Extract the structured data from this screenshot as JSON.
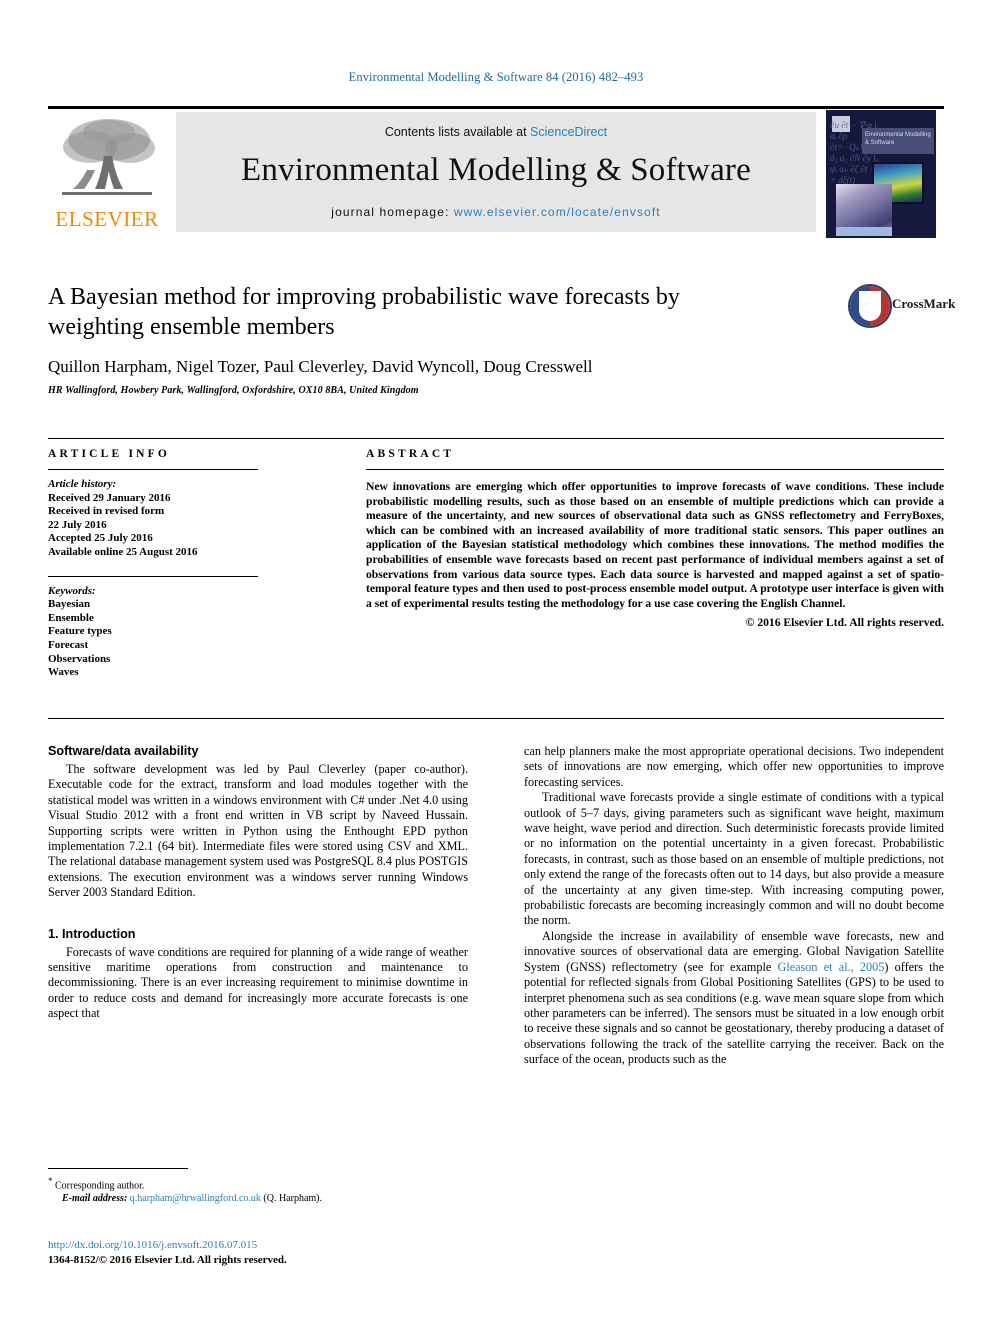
{
  "running_head": "Environmental Modelling & Software 84 (2016) 482–493",
  "masthead": {
    "contents_prefix": "Contents lists available at ",
    "sciencedirect": "ScienceDirect",
    "journal_name": "Environmental Modelling & Software",
    "homepage_prefix": "journal homepage: ",
    "homepage_url": "www.elsevier.com/locate/envsoft",
    "publisher_wordmark": "ELSEVIER",
    "cover_title": "Environmental Modelling & Software",
    "cover_equations": "∂u ∂t − ∇·φ ∫ᵢ αᵢ ∂ρ ∂t=−Qₖ∇ + d₁ a₁ ∂N ∂y ∫₀ ψᵢ αₖ ∂ζ ∂t − + dξ(t)"
  },
  "accent_colors": {
    "link_blue": "#2a7fb8",
    "running_head_blue": "#1a6ba0",
    "elsevier_orange": "#f08a00",
    "crossmark_blue": "#2f4b8c",
    "crossmark_red": "#b8352c"
  },
  "article": {
    "title": "A Bayesian method for improving probabilistic wave forecasts by weighting ensemble members",
    "authors": "Quillon Harpham, Nigel Tozer, Paul Cleverley, David Wyncoll, Doug Cresswell",
    "corresponding_marker": "*",
    "affiliation": "HR Wallingford, Howbery Park, Wallingford, Oxfordshire, OX10 8BA, United Kingdom",
    "crossmark_label": "CrossMark"
  },
  "article_info": {
    "heading": "ARTICLE INFO",
    "history_label": "Article history:",
    "history": [
      "Received 29 January 2016",
      "Received in revised form",
      "22 July 2016",
      "Accepted 25 July 2016",
      "Available online 25 August 2016"
    ],
    "keywords_label": "Keywords:",
    "keywords": [
      "Bayesian",
      "Ensemble",
      "Feature types",
      "Forecast",
      "Observations",
      "Waves"
    ]
  },
  "abstract": {
    "heading": "ABSTRACT",
    "text": "New innovations are emerging which offer opportunities to improve forecasts of wave conditions. These include probabilistic modelling results, such as those based on an ensemble of multiple predictions which can provide a measure of the uncertainty, and new sources of observational data such as GNSS reflectometry and FerryBoxes, which can be combined with an increased availability of more traditional static sensors. This paper outlines an application of the Bayesian statistical methodology which combines these innovations. The method modifies the probabilities of ensemble wave forecasts based on recent past performance of individual members against a set of observations from various data source types. Each data source is harvested and mapped against a set of spatio-temporal feature types and then used to post-process ensemble model output. A prototype user interface is given with a set of experimental results testing the methodology for a use case covering the English Channel.",
    "copyright": "© 2016 Elsevier Ltd. All rights reserved."
  },
  "body": {
    "left_column": {
      "software_heading": "Software/data availability",
      "software_paragraph": "The software development was led by Paul Cleverley (paper co-author). Executable code for the extract, transform and load modules together with the statistical model was written in a windows environment with C# under .Net 4.0 using Visual Studio 2012 with a front end written in VB script by Naveed Hussain. Supporting scripts were written in Python using the Enthought EPD python implementation 7.2.1 (64 bit). Intermediate files were stored using CSV and XML. The relational database management system used was PostgreSQL 8.4 plus POSTGIS extensions. The execution environment was a windows server running Windows Server 2003 Standard Edition.",
      "intro_heading": "1. Introduction",
      "intro_paragraph": "Forecasts of wave conditions are required for planning of a wide range of weather sensitive maritime operations from construction and maintenance to decommissioning. There is an ever increasing requirement to minimise downtime in order to reduce costs and demand for increasingly more accurate forecasts is one aspect that"
    },
    "right_column": {
      "paragraph_1": "can help planners make the most appropriate operational decisions. Two independent sets of innovations are now emerging, which offer new opportunities to improve forecasting services.",
      "paragraph_2": "Traditional wave forecasts provide a single estimate of conditions with a typical outlook of 5–7 days, giving parameters such as significant wave height, maximum wave height, wave period and direction. Such deterministic forecasts provide limited or no information on the potential uncertainty in a given forecast. Probabilistic forecasts, in contrast, such as those based on an ensemble of multiple predictions, not only extend the range of the forecasts often out to 14 days, but also provide a measure of the uncertainty at any given time-step. With increasing computing power, probabilistic forecasts are becoming increasingly common and will no doubt become the norm.",
      "paragraph_3_part1": "Alongside the increase in availability of ensemble wave forecasts, new and innovative sources of observational data are emerging. Global Navigation Satellite System (GNSS) reflectometry (see for example ",
      "paragraph_3_citation": "Gleason et al., 2005",
      "paragraph_3_part2": ") offers the potential for reflected signals from Global Positioning Satellites (GPS) to be used to interpret phenomena such as sea conditions (e.g. wave mean square slope from which other parameters can be inferred). The sensors must be situated in a low enough orbit to receive these signals and so cannot be geostationary, thereby producing a dataset of observations following the track of the satellite carrying the receiver. Back on the surface of the ocean, products such as the"
    }
  },
  "footnotes": {
    "corresponding_marker": "*",
    "corresponding_text": "Corresponding author.",
    "email_label": "E-mail address:",
    "email": "q.harpham@hrwallingford.co.uk",
    "email_attribution": "(Q. Harpham).",
    "doi_url": "http://dx.doi.org/10.1016/j.envsoft.2016.07.015",
    "issn_copyright": "1364-8152/© 2016 Elsevier Ltd. All rights reserved."
  }
}
